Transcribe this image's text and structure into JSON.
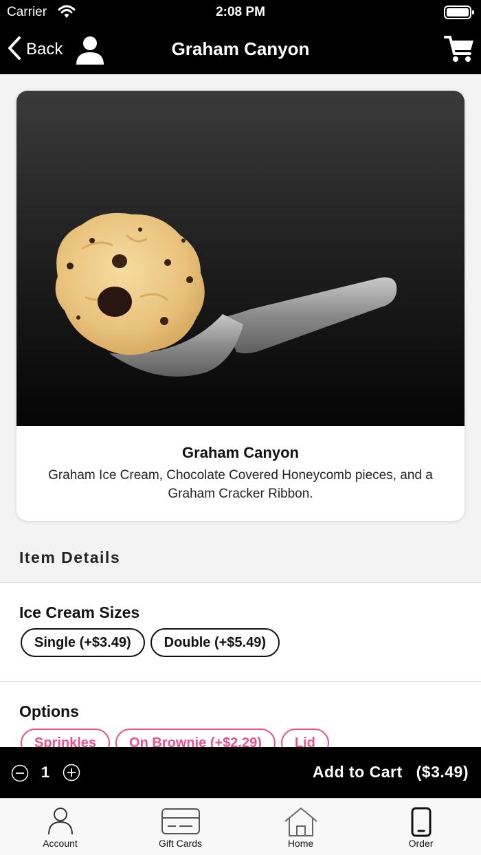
{
  "status_bar": {
    "carrier": "Carrier",
    "time": "2:08 PM"
  },
  "nav": {
    "back_label": "Back",
    "title": "Graham Canyon"
  },
  "product": {
    "name": "Graham Canyon",
    "description": "Graham Ice Cream, Chocolate Covered Honeycomb pieces, and a Graham Cracker Ribbon."
  },
  "item_details": {
    "header": "Item Details",
    "sizes": {
      "title": "Ice Cream Sizes",
      "choices": [
        "Single (+$3.49)",
        "Double (+$5.49)"
      ]
    },
    "options": {
      "title": "Options",
      "choices": [
        "Sprinkles",
        "On Brownie (+$2.29)",
        "Lid"
      ]
    }
  },
  "cart_bar": {
    "quantity": "1",
    "add_label": "Add to Cart",
    "price": "($3.49)"
  },
  "tabs": [
    {
      "label": "Account",
      "icon": "person-icon"
    },
    {
      "label": "Gift Cards",
      "icon": "gift-card-icon"
    },
    {
      "label": "Home",
      "icon": "home-icon"
    },
    {
      "label": "Order",
      "icon": "phone-icon"
    }
  ],
  "colors": {
    "bar": "#000000",
    "background": "#f3f3f3",
    "accent_pink": "#e9528d"
  }
}
